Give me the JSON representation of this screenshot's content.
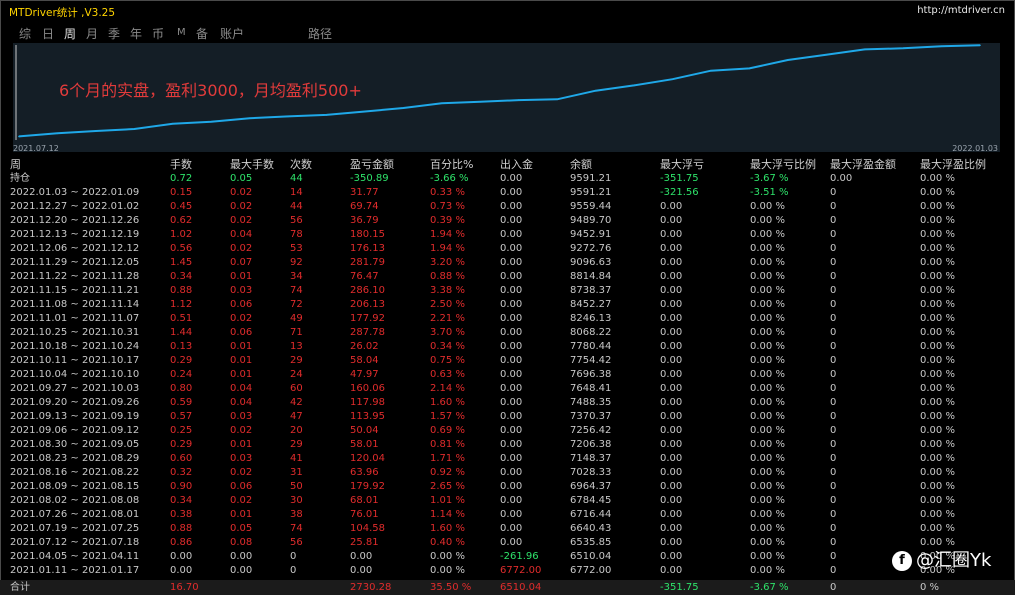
{
  "app": {
    "title": "MTDriver统计 ,V3.25",
    "url": "http://mtdriver.cn"
  },
  "tabs": [
    {
      "label": "综"
    },
    {
      "label": "日"
    },
    {
      "label": "周",
      "active": true
    },
    {
      "label": "月"
    },
    {
      "label": "季"
    },
    {
      "label": "年"
    },
    {
      "label": "币"
    },
    {
      "label": "M"
    },
    {
      "label": "备"
    },
    {
      "label": "账户"
    },
    {
      "label": "路径"
    }
  ],
  "chart": {
    "start_date": "2021.07.12",
    "end_date": "2022.01.03",
    "annotation": "6个月的实盘，盈利3000，月均盈利500+",
    "line_color": "#1fa8e8"
  },
  "chart_data": {
    "type": "line",
    "x": [
      "2021.07.12",
      "2021.07.19",
      "2021.07.26",
      "2021.08.02",
      "2021.08.09",
      "2021.08.16",
      "2021.08.23",
      "2021.08.30",
      "2021.09.06",
      "2021.09.13",
      "2021.09.20",
      "2021.09.27",
      "2021.10.04",
      "2021.10.11",
      "2021.10.18",
      "2021.10.25",
      "2021.11.01",
      "2021.11.08",
      "2021.11.15",
      "2021.11.22",
      "2021.11.29",
      "2021.12.06",
      "2021.12.13",
      "2021.12.20",
      "2021.12.27",
      "2022.01.03"
    ],
    "y": [
      6535.85,
      6640.43,
      6716.44,
      6784.45,
      6964.37,
      7028.33,
      7148.37,
      7206.38,
      7256.42,
      7370.37,
      7488.35,
      7648.41,
      7696.38,
      7754.42,
      7780.44,
      8068.22,
      8246.13,
      8452.27,
      8738.37,
      8814.84,
      9096.63,
      9272.76,
      9452.91,
      9489.7,
      9559.44,
      9591.21
    ],
    "grid": false
  },
  "columns": [
    "周",
    "手数",
    "最大手数",
    "次数",
    "盈亏金额",
    "百分比%",
    "出入金",
    "余额",
    "最大浮亏",
    "最大浮亏比例",
    "最大浮盈金额",
    "最大浮盈比例"
  ],
  "rows": [
    {
      "p": "持仓",
      "lots": "0.72",
      "max": "0.05",
      "n": "44",
      "pl": "-350.89",
      "pct": "-3.66 %",
      "io": "0.00",
      "bal": "9591.21",
      "fl": "-351.75",
      "flp": "-3.67 %",
      "fg": "0.00",
      "fgp": "0.00 %",
      "kind": "hold"
    },
    {
      "p": "2022.01.03 ~ 2022.01.09",
      "lots": "0.15",
      "max": "0.02",
      "n": "14",
      "pl": "31.77",
      "pct": "0.33 %",
      "io": "0.00",
      "bal": "9591.21",
      "fl": "-321.56",
      "flp": "-3.51 %",
      "fg": "0",
      "fgp": "0.00 %",
      "kind": "week"
    },
    {
      "p": "2021.12.27 ~ 2022.01.02",
      "lots": "0.45",
      "max": "0.02",
      "n": "44",
      "pl": "69.74",
      "pct": "0.73 %",
      "io": "0.00",
      "bal": "9559.44",
      "fl": "0.00",
      "flp": "0.00 %",
      "fg": "0",
      "fgp": "0.00 %",
      "kind": "week"
    },
    {
      "p": "2021.12.20 ~ 2021.12.26",
      "lots": "0.62",
      "max": "0.02",
      "n": "56",
      "pl": "36.79",
      "pct": "0.39 %",
      "io": "0.00",
      "bal": "9489.70",
      "fl": "0.00",
      "flp": "0.00 %",
      "fg": "0",
      "fgp": "0.00 %",
      "kind": "week"
    },
    {
      "p": "2021.12.13 ~ 2021.12.19",
      "lots": "1.02",
      "max": "0.04",
      "n": "78",
      "pl": "180.15",
      "pct": "1.94 %",
      "io": "0.00",
      "bal": "9452.91",
      "fl": "0.00",
      "flp": "0.00 %",
      "fg": "0",
      "fgp": "0.00 %",
      "kind": "week"
    },
    {
      "p": "2021.12.06 ~ 2021.12.12",
      "lots": "0.56",
      "max": "0.02",
      "n": "53",
      "pl": "176.13",
      "pct": "1.94 %",
      "io": "0.00",
      "bal": "9272.76",
      "fl": "0.00",
      "flp": "0.00 %",
      "fg": "0",
      "fgp": "0.00 %",
      "kind": "week"
    },
    {
      "p": "2021.11.29 ~ 2021.12.05",
      "lots": "1.45",
      "max": "0.07",
      "n": "92",
      "pl": "281.79",
      "pct": "3.20 %",
      "io": "0.00",
      "bal": "9096.63",
      "fl": "0.00",
      "flp": "0.00 %",
      "fg": "0",
      "fgp": "0.00 %",
      "kind": "week"
    },
    {
      "p": "2021.11.22 ~ 2021.11.28",
      "lots": "0.34",
      "max": "0.01",
      "n": "34",
      "pl": "76.47",
      "pct": "0.88 %",
      "io": "0.00",
      "bal": "8814.84",
      "fl": "0.00",
      "flp": "0.00 %",
      "fg": "0",
      "fgp": "0.00 %",
      "kind": "week"
    },
    {
      "p": "2021.11.15 ~ 2021.11.21",
      "lots": "0.88",
      "max": "0.03",
      "n": "74",
      "pl": "286.10",
      "pct": "3.38 %",
      "io": "0.00",
      "bal": "8738.37",
      "fl": "0.00",
      "flp": "0.00 %",
      "fg": "0",
      "fgp": "0.00 %",
      "kind": "week"
    },
    {
      "p": "2021.11.08 ~ 2021.11.14",
      "lots": "1.12",
      "max": "0.06",
      "n": "72",
      "pl": "206.13",
      "pct": "2.50 %",
      "io": "0.00",
      "bal": "8452.27",
      "fl": "0.00",
      "flp": "0.00 %",
      "fg": "0",
      "fgp": "0.00 %",
      "kind": "week"
    },
    {
      "p": "2021.11.01 ~ 2021.11.07",
      "lots": "0.51",
      "max": "0.02",
      "n": "49",
      "pl": "177.92",
      "pct": "2.21 %",
      "io": "0.00",
      "bal": "8246.13",
      "fl": "0.00",
      "flp": "0.00 %",
      "fg": "0",
      "fgp": "0.00 %",
      "kind": "week"
    },
    {
      "p": "2021.10.25 ~ 2021.10.31",
      "lots": "1.44",
      "max": "0.06",
      "n": "71",
      "pl": "287.78",
      "pct": "3.70 %",
      "io": "0.00",
      "bal": "8068.22",
      "fl": "0.00",
      "flp": "0.00 %",
      "fg": "0",
      "fgp": "0.00 %",
      "kind": "week"
    },
    {
      "p": "2021.10.18 ~ 2021.10.24",
      "lots": "0.13",
      "max": "0.01",
      "n": "13",
      "pl": "26.02",
      "pct": "0.34 %",
      "io": "0.00",
      "bal": "7780.44",
      "fl": "0.00",
      "flp": "0.00 %",
      "fg": "0",
      "fgp": "0.00 %",
      "kind": "week"
    },
    {
      "p": "2021.10.11 ~ 2021.10.17",
      "lots": "0.29",
      "max": "0.01",
      "n": "29",
      "pl": "58.04",
      "pct": "0.75 %",
      "io": "0.00",
      "bal": "7754.42",
      "fl": "0.00",
      "flp": "0.00 %",
      "fg": "0",
      "fgp": "0.00 %",
      "kind": "week"
    },
    {
      "p": "2021.10.04 ~ 2021.10.10",
      "lots": "0.24",
      "max": "0.01",
      "n": "24",
      "pl": "47.97",
      "pct": "0.63 %",
      "io": "0.00",
      "bal": "7696.38",
      "fl": "0.00",
      "flp": "0.00 %",
      "fg": "0",
      "fgp": "0.00 %",
      "kind": "week"
    },
    {
      "p": "2021.09.27 ~ 2021.10.03",
      "lots": "0.80",
      "max": "0.04",
      "n": "60",
      "pl": "160.06",
      "pct": "2.14 %",
      "io": "0.00",
      "bal": "7648.41",
      "fl": "0.00",
      "flp": "0.00 %",
      "fg": "0",
      "fgp": "0.00 %",
      "kind": "week"
    },
    {
      "p": "2021.09.20 ~ 2021.09.26",
      "lots": "0.59",
      "max": "0.04",
      "n": "42",
      "pl": "117.98",
      "pct": "1.60 %",
      "io": "0.00",
      "bal": "7488.35",
      "fl": "0.00",
      "flp": "0.00 %",
      "fg": "0",
      "fgp": "0.00 %",
      "kind": "week"
    },
    {
      "p": "2021.09.13 ~ 2021.09.19",
      "lots": "0.57",
      "max": "0.03",
      "n": "47",
      "pl": "113.95",
      "pct": "1.57 %",
      "io": "0.00",
      "bal": "7370.37",
      "fl": "0.00",
      "flp": "0.00 %",
      "fg": "0",
      "fgp": "0.00 %",
      "kind": "week"
    },
    {
      "p": "2021.09.06 ~ 2021.09.12",
      "lots": "0.25",
      "max": "0.02",
      "n": "20",
      "pl": "50.04",
      "pct": "0.69 %",
      "io": "0.00",
      "bal": "7256.42",
      "fl": "0.00",
      "flp": "0.00 %",
      "fg": "0",
      "fgp": "0.00 %",
      "kind": "week"
    },
    {
      "p": "2021.08.30 ~ 2021.09.05",
      "lots": "0.29",
      "max": "0.01",
      "n": "29",
      "pl": "58.01",
      "pct": "0.81 %",
      "io": "0.00",
      "bal": "7206.38",
      "fl": "0.00",
      "flp": "0.00 %",
      "fg": "0",
      "fgp": "0.00 %",
      "kind": "week"
    },
    {
      "p": "2021.08.23 ~ 2021.08.29",
      "lots": "0.60",
      "max": "0.03",
      "n": "41",
      "pl": "120.04",
      "pct": "1.71 %",
      "io": "0.00",
      "bal": "7148.37",
      "fl": "0.00",
      "flp": "0.00 %",
      "fg": "0",
      "fgp": "0.00 %",
      "kind": "week"
    },
    {
      "p": "2021.08.16 ~ 2021.08.22",
      "lots": "0.32",
      "max": "0.02",
      "n": "31",
      "pl": "63.96",
      "pct": "0.92 %",
      "io": "0.00",
      "bal": "7028.33",
      "fl": "0.00",
      "flp": "0.00 %",
      "fg": "0",
      "fgp": "0.00 %",
      "kind": "week"
    },
    {
      "p": "2021.08.09 ~ 2021.08.15",
      "lots": "0.90",
      "max": "0.06",
      "n": "50",
      "pl": "179.92",
      "pct": "2.65 %",
      "io": "0.00",
      "bal": "6964.37",
      "fl": "0.00",
      "flp": "0.00 %",
      "fg": "0",
      "fgp": "0.00 %",
      "kind": "week"
    },
    {
      "p": "2021.08.02 ~ 2021.08.08",
      "lots": "0.34",
      "max": "0.02",
      "n": "30",
      "pl": "68.01",
      "pct": "1.01 %",
      "io": "0.00",
      "bal": "6784.45",
      "fl": "0.00",
      "flp": "0.00 %",
      "fg": "0",
      "fgp": "0.00 %",
      "kind": "week"
    },
    {
      "p": "2021.07.26 ~ 2021.08.01",
      "lots": "0.38",
      "max": "0.01",
      "n": "38",
      "pl": "76.01",
      "pct": "1.14 %",
      "io": "0.00",
      "bal": "6716.44",
      "fl": "0.00",
      "flp": "0.00 %",
      "fg": "0",
      "fgp": "0.00 %",
      "kind": "week"
    },
    {
      "p": "2021.07.19 ~ 2021.07.25",
      "lots": "0.88",
      "max": "0.05",
      "n": "74",
      "pl": "104.58",
      "pct": "1.60 %",
      "io": "0.00",
      "bal": "6640.43",
      "fl": "0.00",
      "flp": "0.00 %",
      "fg": "0",
      "fgp": "0.00 %",
      "kind": "week"
    },
    {
      "p": "2021.07.12 ~ 2021.07.18",
      "lots": "0.86",
      "max": "0.08",
      "n": "56",
      "pl": "25.81",
      "pct": "0.40 %",
      "io": "0.00",
      "bal": "6535.85",
      "fl": "0.00",
      "flp": "0.00 %",
      "fg": "0",
      "fgp": "0.00 %",
      "kind": "week"
    },
    {
      "p": "2021.04.05 ~ 2021.04.11",
      "lots": "0.00",
      "max": "0.00",
      "n": "0",
      "pl": "0.00",
      "pct": "0.00 %",
      "io": "-261.96",
      "bal": "6510.04",
      "fl": "0.00",
      "flp": "0.00 %",
      "fg": "0",
      "fgp": "0.00 %",
      "kind": "out"
    },
    {
      "p": "2021.01.11 ~ 2021.01.17",
      "lots": "0.00",
      "max": "0.00",
      "n": "0",
      "pl": "0.00",
      "pct": "0.00 %",
      "io": "6772.00",
      "bal": "6772.00",
      "fl": "0.00",
      "flp": "0.00 %",
      "fg": "0",
      "fgp": "0.00 %",
      "kind": "in"
    },
    {
      "p": "合计",
      "lots": "16.70",
      "max": "",
      "n": "",
      "pl": "2730.28",
      "pct": "35.50 %",
      "io": "6510.04",
      "bal": "",
      "fl": "-351.75",
      "flp": "-3.67 %",
      "fg": "0",
      "fgp": "0 %",
      "kind": "total"
    }
  ],
  "watermark": {
    "icon": "f",
    "text": "@汇圈Yk"
  },
  "colors": {
    "profit": "#e02c2c",
    "loss": "#2ee26a",
    "neutral": "#c8c8c8",
    "title": "#ffd400"
  }
}
